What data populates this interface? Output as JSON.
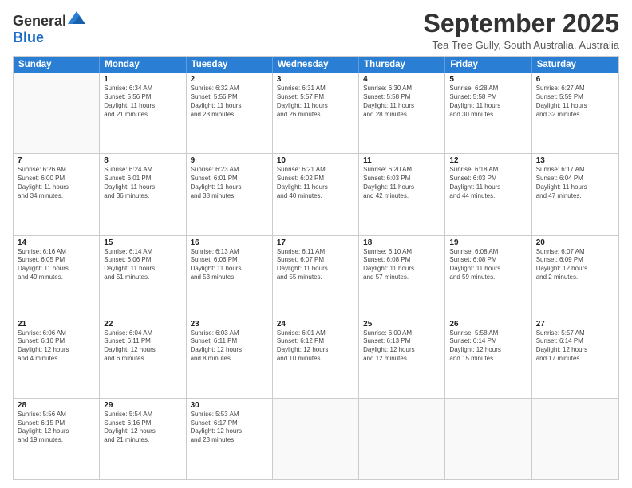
{
  "logo": {
    "general": "General",
    "blue": "Blue"
  },
  "header": {
    "month": "September 2025",
    "location": "Tea Tree Gully, South Australia, Australia"
  },
  "days": [
    "Sunday",
    "Monday",
    "Tuesday",
    "Wednesday",
    "Thursday",
    "Friday",
    "Saturday"
  ],
  "weeks": [
    [
      {
        "day": "",
        "info": ""
      },
      {
        "day": "1",
        "info": "Sunrise: 6:34 AM\nSunset: 5:56 PM\nDaylight: 11 hours\nand 21 minutes."
      },
      {
        "day": "2",
        "info": "Sunrise: 6:32 AM\nSunset: 5:56 PM\nDaylight: 11 hours\nand 23 minutes."
      },
      {
        "day": "3",
        "info": "Sunrise: 6:31 AM\nSunset: 5:57 PM\nDaylight: 11 hours\nand 26 minutes."
      },
      {
        "day": "4",
        "info": "Sunrise: 6:30 AM\nSunset: 5:58 PM\nDaylight: 11 hours\nand 28 minutes."
      },
      {
        "day": "5",
        "info": "Sunrise: 6:28 AM\nSunset: 5:58 PM\nDaylight: 11 hours\nand 30 minutes."
      },
      {
        "day": "6",
        "info": "Sunrise: 6:27 AM\nSunset: 5:59 PM\nDaylight: 11 hours\nand 32 minutes."
      }
    ],
    [
      {
        "day": "7",
        "info": "Sunrise: 6:26 AM\nSunset: 6:00 PM\nDaylight: 11 hours\nand 34 minutes."
      },
      {
        "day": "8",
        "info": "Sunrise: 6:24 AM\nSunset: 6:01 PM\nDaylight: 11 hours\nand 36 minutes."
      },
      {
        "day": "9",
        "info": "Sunrise: 6:23 AM\nSunset: 6:01 PM\nDaylight: 11 hours\nand 38 minutes."
      },
      {
        "day": "10",
        "info": "Sunrise: 6:21 AM\nSunset: 6:02 PM\nDaylight: 11 hours\nand 40 minutes."
      },
      {
        "day": "11",
        "info": "Sunrise: 6:20 AM\nSunset: 6:03 PM\nDaylight: 11 hours\nand 42 minutes."
      },
      {
        "day": "12",
        "info": "Sunrise: 6:18 AM\nSunset: 6:03 PM\nDaylight: 11 hours\nand 44 minutes."
      },
      {
        "day": "13",
        "info": "Sunrise: 6:17 AM\nSunset: 6:04 PM\nDaylight: 11 hours\nand 47 minutes."
      }
    ],
    [
      {
        "day": "14",
        "info": "Sunrise: 6:16 AM\nSunset: 6:05 PM\nDaylight: 11 hours\nand 49 minutes."
      },
      {
        "day": "15",
        "info": "Sunrise: 6:14 AM\nSunset: 6:06 PM\nDaylight: 11 hours\nand 51 minutes."
      },
      {
        "day": "16",
        "info": "Sunrise: 6:13 AM\nSunset: 6:06 PM\nDaylight: 11 hours\nand 53 minutes."
      },
      {
        "day": "17",
        "info": "Sunrise: 6:11 AM\nSunset: 6:07 PM\nDaylight: 11 hours\nand 55 minutes."
      },
      {
        "day": "18",
        "info": "Sunrise: 6:10 AM\nSunset: 6:08 PM\nDaylight: 11 hours\nand 57 minutes."
      },
      {
        "day": "19",
        "info": "Sunrise: 6:08 AM\nSunset: 6:08 PM\nDaylight: 11 hours\nand 59 minutes."
      },
      {
        "day": "20",
        "info": "Sunrise: 6:07 AM\nSunset: 6:09 PM\nDaylight: 12 hours\nand 2 minutes."
      }
    ],
    [
      {
        "day": "21",
        "info": "Sunrise: 6:06 AM\nSunset: 6:10 PM\nDaylight: 12 hours\nand 4 minutes."
      },
      {
        "day": "22",
        "info": "Sunrise: 6:04 AM\nSunset: 6:11 PM\nDaylight: 12 hours\nand 6 minutes."
      },
      {
        "day": "23",
        "info": "Sunrise: 6:03 AM\nSunset: 6:11 PM\nDaylight: 12 hours\nand 8 minutes."
      },
      {
        "day": "24",
        "info": "Sunrise: 6:01 AM\nSunset: 6:12 PM\nDaylight: 12 hours\nand 10 minutes."
      },
      {
        "day": "25",
        "info": "Sunrise: 6:00 AM\nSunset: 6:13 PM\nDaylight: 12 hours\nand 12 minutes."
      },
      {
        "day": "26",
        "info": "Sunrise: 5:58 AM\nSunset: 6:14 PM\nDaylight: 12 hours\nand 15 minutes."
      },
      {
        "day": "27",
        "info": "Sunrise: 5:57 AM\nSunset: 6:14 PM\nDaylight: 12 hours\nand 17 minutes."
      }
    ],
    [
      {
        "day": "28",
        "info": "Sunrise: 5:56 AM\nSunset: 6:15 PM\nDaylight: 12 hours\nand 19 minutes."
      },
      {
        "day": "29",
        "info": "Sunrise: 5:54 AM\nSunset: 6:16 PM\nDaylight: 12 hours\nand 21 minutes."
      },
      {
        "day": "30",
        "info": "Sunrise: 5:53 AM\nSunset: 6:17 PM\nDaylight: 12 hours\nand 23 minutes."
      },
      {
        "day": "",
        "info": ""
      },
      {
        "day": "",
        "info": ""
      },
      {
        "day": "",
        "info": ""
      },
      {
        "day": "",
        "info": ""
      }
    ]
  ]
}
